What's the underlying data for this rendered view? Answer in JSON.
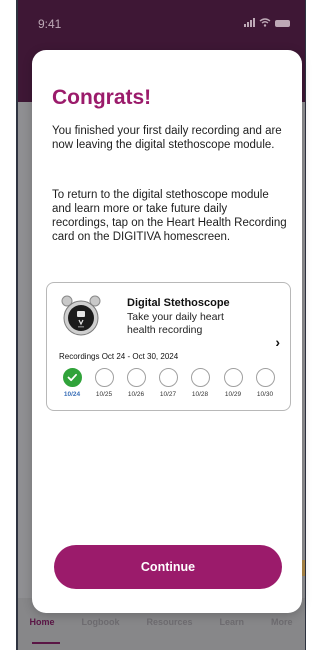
{
  "status_bar": {
    "time": "9:41"
  },
  "modal": {
    "title": "Congrats!",
    "paragraph1": "You finished your first daily recording and are now leaving the digital stethoscope module.",
    "paragraph2": "To return to the digital stethoscope module and learn more or take future daily recordings, tap on the Heart Health Recording card on the DIGITIVA homescreen.",
    "continue_label": "Continue"
  },
  "card": {
    "title": "Digital Stethoscope",
    "description": "Take your daily heart health recording",
    "recordings_label": "Recordings Oct 24 - Oct 30, 2024",
    "days": [
      {
        "label": "10/24",
        "completed": true
      },
      {
        "label": "10/25",
        "completed": false
      },
      {
        "label": "10/26",
        "completed": false
      },
      {
        "label": "10/27",
        "completed": false
      },
      {
        "label": "10/28",
        "completed": false
      },
      {
        "label": "10/29",
        "completed": false
      },
      {
        "label": "10/30",
        "completed": false
      }
    ]
  },
  "tab_bar": {
    "items": [
      {
        "label": "Home",
        "active": true
      },
      {
        "label": "Logbook",
        "active": false
      },
      {
        "label": "Resources",
        "active": false
      },
      {
        "label": "Learn",
        "active": false
      },
      {
        "label": "More",
        "active": false
      }
    ]
  },
  "colors": {
    "accent": "#9b1b6b",
    "header": "#3e1735",
    "success": "#30a33a",
    "today_label": "#3a6fb8"
  },
  "icons": [
    "signal-icon",
    "wifi-icon",
    "battery-icon",
    "stethoscope-icon",
    "chevron-right-icon",
    "checkmark-icon"
  ]
}
